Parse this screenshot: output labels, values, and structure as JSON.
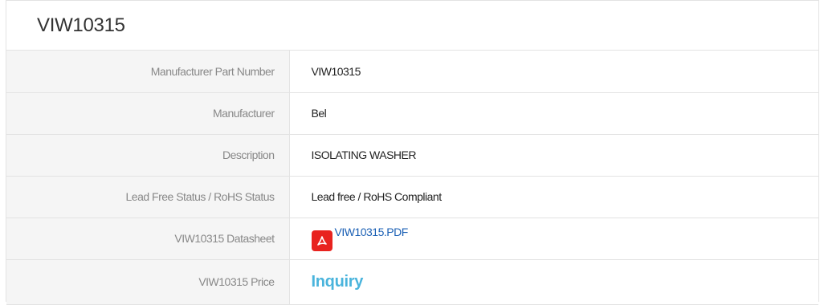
{
  "header": {
    "title": "VIW10315"
  },
  "specs": {
    "rows": [
      {
        "label": "Manufacturer Part Number",
        "value": "VIW10315"
      },
      {
        "label": "Manufacturer",
        "value": "Bel"
      },
      {
        "label": "Description",
        "value": "ISOLATING WASHER"
      },
      {
        "label": "Lead Free Status / RoHS Status",
        "value": "Lead free / RoHS Compliant"
      },
      {
        "label": "VIW10315 Datasheet",
        "value": "VIW10315.PDF"
      },
      {
        "label": "VIW10315 Price",
        "value": "Inquiry"
      }
    ]
  },
  "icons": {
    "datasheet": "pdf-icon"
  },
  "colors": {
    "pdf_icon": "#e8231f",
    "link": "#1a5fb4",
    "inquiry": "#4ab4dc",
    "label_bg": "#f5f5f5",
    "border": "#e3e3e3"
  }
}
